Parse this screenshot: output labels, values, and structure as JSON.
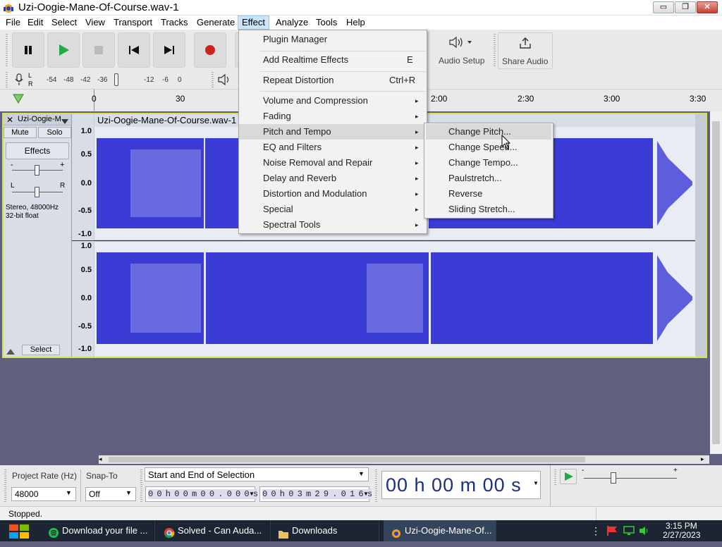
{
  "window": {
    "title": "Uzi-Oogie-Mane-Of-Course.wav-1",
    "minimize": "▭",
    "restore": "❐",
    "close": "✕"
  },
  "menubar": [
    "File",
    "Edit",
    "Select",
    "View",
    "Transport",
    "Tracks",
    "Generate",
    "Effect",
    "Analyze",
    "Tools",
    "Help"
  ],
  "toolbar": {
    "audio_setup": "Audio Setup",
    "share_audio": "Share Audio",
    "meter_ticks": [
      "-54",
      "-48",
      "-42",
      "-36",
      "-12",
      "-6",
      "0"
    ],
    "meter_lr": [
      "L",
      "R"
    ]
  },
  "timeline": {
    "ticks": [
      "0",
      "30",
      "2:00",
      "2:30",
      "3:00",
      "3:30"
    ]
  },
  "track": {
    "name": "Uzi-Oogie-M",
    "clip_title": "Uzi-Oogie-Mane-Of-Course.wav-1",
    "mute": "Mute",
    "solo": "Solo",
    "effects": "Effects",
    "gain_minus": "-",
    "gain_plus": "+",
    "pan_l": "L",
    "pan_r": "R",
    "info": "Stereo, 48000Hz",
    "format": "32-bit float",
    "select": "Select",
    "db_top": [
      "1.0",
      "0.5",
      "0.0",
      "-0.5",
      "-1.0"
    ],
    "db_bottom": [
      "1.0",
      "0.5",
      "0.0",
      "-0.5",
      "-1.0"
    ]
  },
  "effect_menu": {
    "items": [
      {
        "label": "Plugin Manager",
        "shortcut": ""
      },
      {
        "label": "Add Realtime Effects",
        "shortcut": "E"
      },
      {
        "label": "Repeat Distortion",
        "shortcut": "Ctrl+R"
      },
      {
        "label": "Volume and Compression",
        "shortcut": ""
      },
      {
        "label": "Fading",
        "shortcut": ""
      },
      {
        "label": "Pitch and Tempo",
        "shortcut": ""
      },
      {
        "label": "EQ and Filters",
        "shortcut": ""
      },
      {
        "label": "Noise Removal and Repair",
        "shortcut": ""
      },
      {
        "label": "Delay and Reverb",
        "shortcut": ""
      },
      {
        "label": "Distortion and Modulation",
        "shortcut": ""
      },
      {
        "label": "Special",
        "shortcut": ""
      },
      {
        "label": "Spectral Tools",
        "shortcut": ""
      }
    ]
  },
  "pitch_submenu": {
    "items": [
      "Change Pitch...",
      "Change Speed...",
      "Change Tempo...",
      "Paulstretch...",
      "Reverse",
      "Sliding Stretch..."
    ]
  },
  "selection_bar": {
    "project_rate_label": "Project Rate (Hz)",
    "project_rate_value": "48000",
    "snap_label": "Snap-To",
    "snap_value": "Off",
    "selection_mode": "Start and End of Selection",
    "start_time": "0 0 h 0 0 m 0 0 . 0 0 0 s",
    "end_time": "0 0 h 0 3 m 2 9 . 0 1 6 s",
    "big_time": "00 h 00 m 00 s",
    "speed_minus": "-",
    "speed_plus": "+"
  },
  "status": {
    "text": "Stopped."
  },
  "taskbar": {
    "tasks": [
      "Download your file ...",
      "Solved - Can Auda...",
      "Downloads",
      "Uzi-Oogie-Mane-Of..."
    ],
    "time": "3:15 PM",
    "date": "2/27/2023"
  },
  "colors": {
    "waveform": "#3b3bd6",
    "track_border": "#d8e04e",
    "record": "#cc2222",
    "play": "#22aa44"
  }
}
